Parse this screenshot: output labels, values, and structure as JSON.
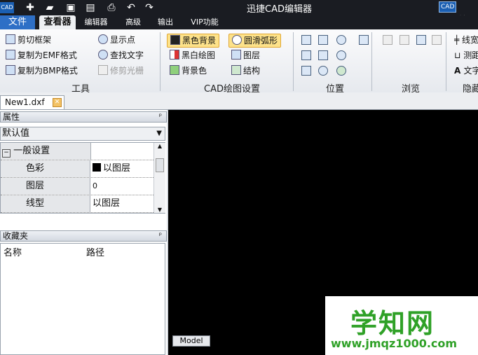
{
  "window": {
    "title": "迅捷CAD编辑器",
    "right_tag_logo": "CAD",
    "right_tag_text": "CAD编"
  },
  "app_logo_text": "CAD",
  "quick_access": [
    "new-icon",
    "open-icon",
    "save-icon",
    "save-as-icon",
    "print-icon",
    "undo-icon",
    "redo-icon"
  ],
  "menu_tabs": {
    "file": "文件",
    "viewer": "查看器",
    "editor": "编辑器",
    "advanced": "高级",
    "output": "输出",
    "vip": "VIP功能"
  },
  "ribbon": {
    "tools": {
      "label": "工具",
      "crop_frame": "剪切框架",
      "copy_emf": "复制为EMF格式",
      "copy_bmp": "复制为BMP格式",
      "show_points": "显示点",
      "find_text": "查找文字",
      "trim_raster": "修剪光栅"
    },
    "cad_settings": {
      "label": "CAD绘图设置",
      "black_bg": "黑色背景",
      "bw_drawing": "黑白绘图",
      "bg_color": "背景色",
      "smooth_arc": "圆滑弧形",
      "layers": "图层",
      "structure": "结构"
    },
    "position": {
      "label": "位置"
    },
    "browse": {
      "label": "浏览"
    },
    "hidden": {
      "label": "隐藏",
      "line_width": "线宽",
      "measure": "测距",
      "text": "文字"
    }
  },
  "document_tab": {
    "name": "New1.dxf"
  },
  "properties": {
    "header": "属性",
    "default_value": "默认值",
    "category": "一般设置",
    "rows": [
      {
        "name": "色彩",
        "value": "以图层"
      },
      {
        "name": "图层",
        "value": "0"
      },
      {
        "name": "线型",
        "value": "以图层"
      }
    ]
  },
  "favorites": {
    "header": "收藏夹",
    "col_name": "名称",
    "col_path": "路径"
  },
  "canvas": {
    "model_tab": "Model"
  },
  "watermark": {
    "title": "学知网",
    "url": "www.jmqz1000.com"
  }
}
